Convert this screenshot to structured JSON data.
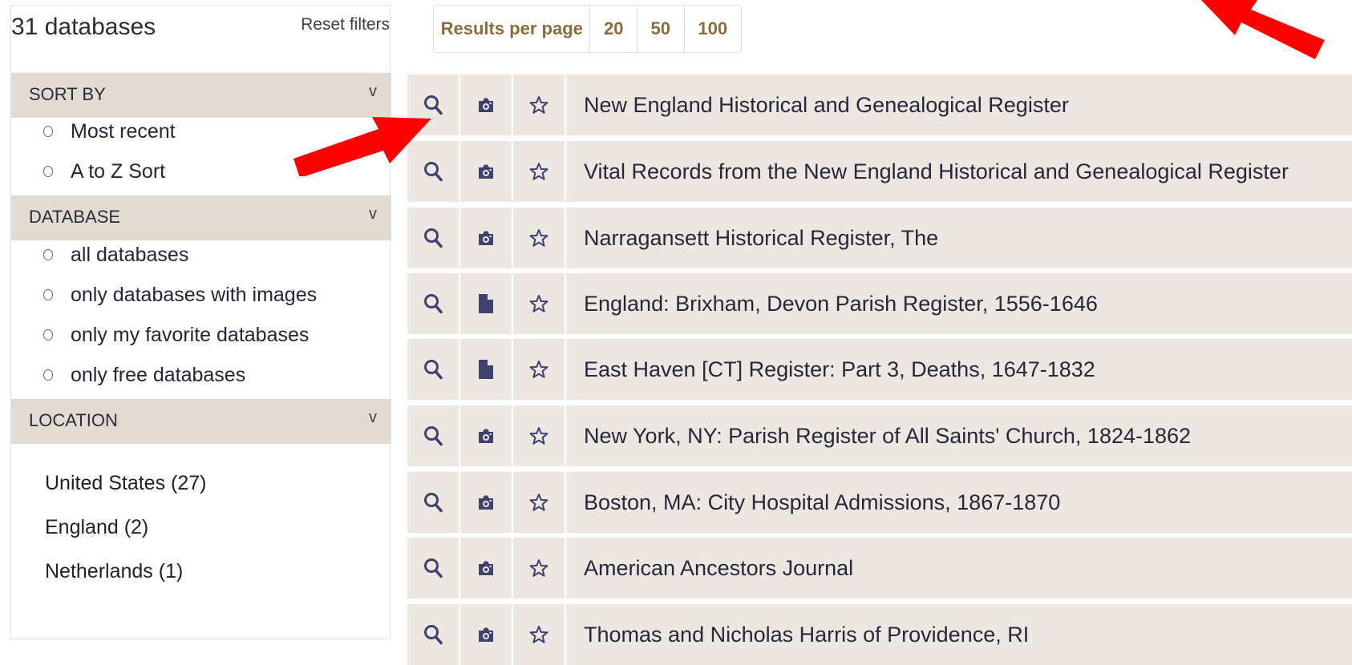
{
  "sidebar": {
    "count": "31 databases",
    "reset": "Reset filters",
    "sort": {
      "header": "SORT BY",
      "chevron": "v",
      "options": [
        "Most recent",
        "A to Z Sort"
      ]
    },
    "database": {
      "header": "DATABASE",
      "chevron": "v",
      "options": [
        "all databases",
        "only databases with images",
        "only my favorite databases",
        "only free databases"
      ]
    },
    "location": {
      "header": "LOCATION",
      "chevron": "v",
      "items": [
        "United States (27)",
        "England (2)",
        "Netherlands (1)"
      ]
    }
  },
  "pagination": {
    "label": "Results per page",
    "options": [
      "20",
      "50",
      "100"
    ]
  },
  "results": [
    {
      "title": "New England Historical and Genealogical Register",
      "type_icon": "camera-icon"
    },
    {
      "title": "Vital Records from the New England Historical and Genealogical Register",
      "type_icon": "camera-icon"
    },
    {
      "title": "Narragansett Historical Register, The",
      "type_icon": "camera-icon"
    },
    {
      "title": "England: Brixham, Devon Parish Register, 1556-1646",
      "type_icon": "document-icon"
    },
    {
      "title": "East Haven [CT] Register: Part 3, Deaths, 1647-1832",
      "type_icon": "document-icon"
    },
    {
      "title": "New York, NY: Parish Register of All Saints' Church, 1824-1862",
      "type_icon": "camera-icon"
    },
    {
      "title": "Boston, MA: City Hospital Admissions, 1867-1870",
      "type_icon": "camera-icon"
    },
    {
      "title": "American Ancestors Journal",
      "type_icon": "camera-icon"
    },
    {
      "title": "Thomas and Nicholas Harris of Providence, RI",
      "type_icon": "camera-icon"
    }
  ],
  "colors": {
    "row_bg": "#ece8e1",
    "section_bg": "#e1dbd2",
    "accent_gold": "#8a6d3b",
    "icon_navy": "#3f4270",
    "arrow_red": "#ff0000"
  }
}
